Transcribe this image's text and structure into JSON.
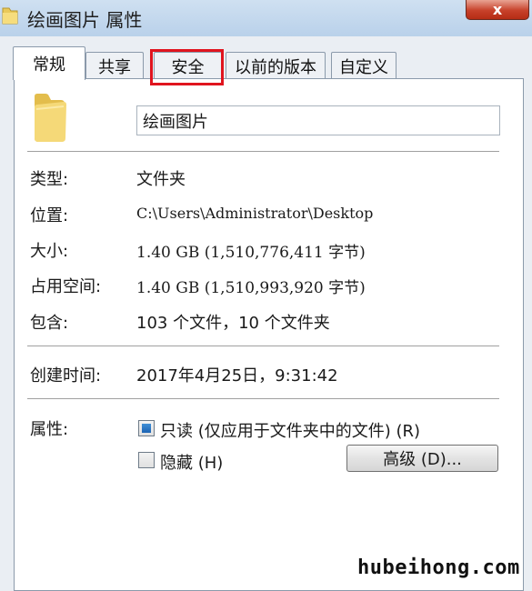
{
  "window": {
    "title": "绘画图片 属性",
    "close_label": "x"
  },
  "tabs": [
    {
      "label": "常规",
      "active": true
    },
    {
      "label": "共享",
      "active": false
    },
    {
      "label": "安全",
      "active": false,
      "highlighted": true
    },
    {
      "label": "以前的版本",
      "active": false
    },
    {
      "label": "自定义",
      "active": false
    }
  ],
  "general": {
    "name_value": "绘画图片",
    "properties": [
      {
        "label": "类型:",
        "value": "文件夹"
      },
      {
        "label": "位置:",
        "value": "C:\\Users\\Administrator\\Desktop"
      },
      {
        "label": "大小:",
        "value": "1.40 GB (1,510,776,411 字节)"
      },
      {
        "label": "占用空间:",
        "value": "1.40 GB (1,510,993,920 字节)"
      },
      {
        "label": "包含:",
        "value": "103 个文件，10 个文件夹"
      }
    ],
    "created": {
      "label": "创建时间:",
      "value": "2017年4月25日，9:31:42"
    },
    "attributes": {
      "label": "属性:",
      "readonly_label": "只读 (仅应用于文件夹中的文件) (R)",
      "readonly_state": "indeterminate",
      "hidden_label": "隐藏 (H)",
      "hidden_checked": false,
      "advanced_button": "高级 (D)..."
    }
  },
  "watermark": "hubeihong.com",
  "colors": {
    "highlight_box": "#e0141e",
    "folder_yellow": "#f2d66c"
  }
}
